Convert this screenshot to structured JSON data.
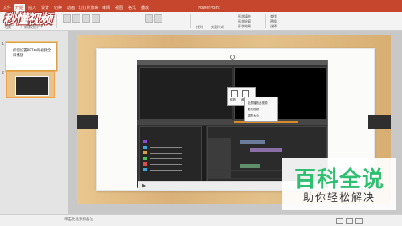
{
  "app": {
    "title": "PowerPoint",
    "tabs": [
      "文件",
      "开始",
      "插入",
      "设计",
      "切换",
      "动画",
      "幻灯片放映",
      "审阅",
      "视图",
      "格式",
      "播放"
    ],
    "active_tab": "开始",
    "ribbon_labels": [
      "粘贴",
      "新建幻灯片",
      "版式",
      "重置",
      "节",
      "排列",
      "快速样式",
      "形状填充",
      "形状轮廓",
      "形状效果",
      "查找",
      "替换",
      "选择"
    ]
  },
  "logo_text": "秒懂视频",
  "thumbnails": [
    {
      "num": "1",
      "text": "如何设置PPT中的视频全屏播放"
    },
    {
      "num": "2",
      "text": ""
    }
  ],
  "popup": {
    "icons": [
      "缩放",
      "裁剪"
    ],
    "menu_items": [
      "全屏播放此视频",
      "更改视频",
      "调整大小"
    ]
  },
  "status_text": "单击此处添加备注",
  "watermark": {
    "title": "百科全说",
    "subtitle": "助你轻松解决"
  },
  "colors": {
    "accent": "#c5462c",
    "brand_green": "#2fbf71"
  }
}
